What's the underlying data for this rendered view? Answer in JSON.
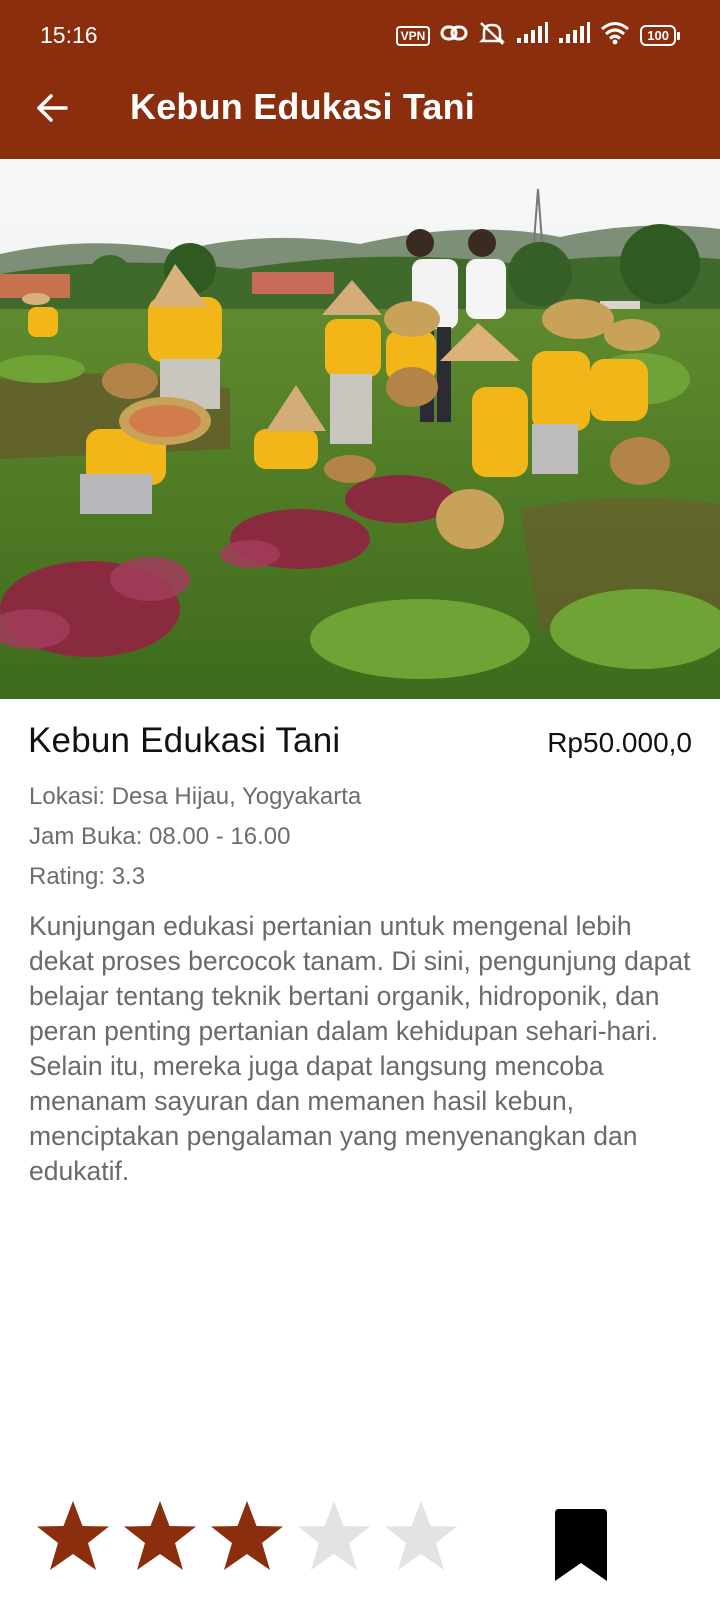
{
  "status_bar": {
    "time": "15:16",
    "vpn_label": "VPN",
    "battery_level": "100",
    "icons": [
      "vpn-icon",
      "link-icon",
      "mute-icon",
      "signal-icon",
      "signal-icon",
      "wifi-icon",
      "battery-icon"
    ]
  },
  "toolbar": {
    "back_icon": "arrow-left-icon",
    "title": "Kebun Edukasi Tani"
  },
  "colors": {
    "appbar": "#8b2e0e",
    "star_filled": "#8b2e0e",
    "star_empty": "#e3e3e3",
    "bookmark": "#000000"
  },
  "detail": {
    "name": "Kebun Edukasi Tani",
    "price": "Rp50.000,0",
    "location": "Lokasi: Desa Hijau, Yogyakarta",
    "hours": "Jam Buka: 08.00 - 16.00",
    "rating": "Rating: 3.3",
    "description": "Kunjungan edukasi pertanian untuk mengenal lebih dekat proses bercocok tanam. Di sini, pengunjung dapat belajar tentang teknik bertani organik, hidroponik, dan peran penting pertanian dalam kehidupan sehari-hari. Selain itu, mereka juga dapat langsung mencoba menanam sayuran dan memanen hasil kebun, menciptakan pengalaman yang menyenangkan dan edukatif."
  },
  "rating_stars": {
    "filled": 3,
    "total": 5
  },
  "bookmark_icon": "bookmark-icon"
}
